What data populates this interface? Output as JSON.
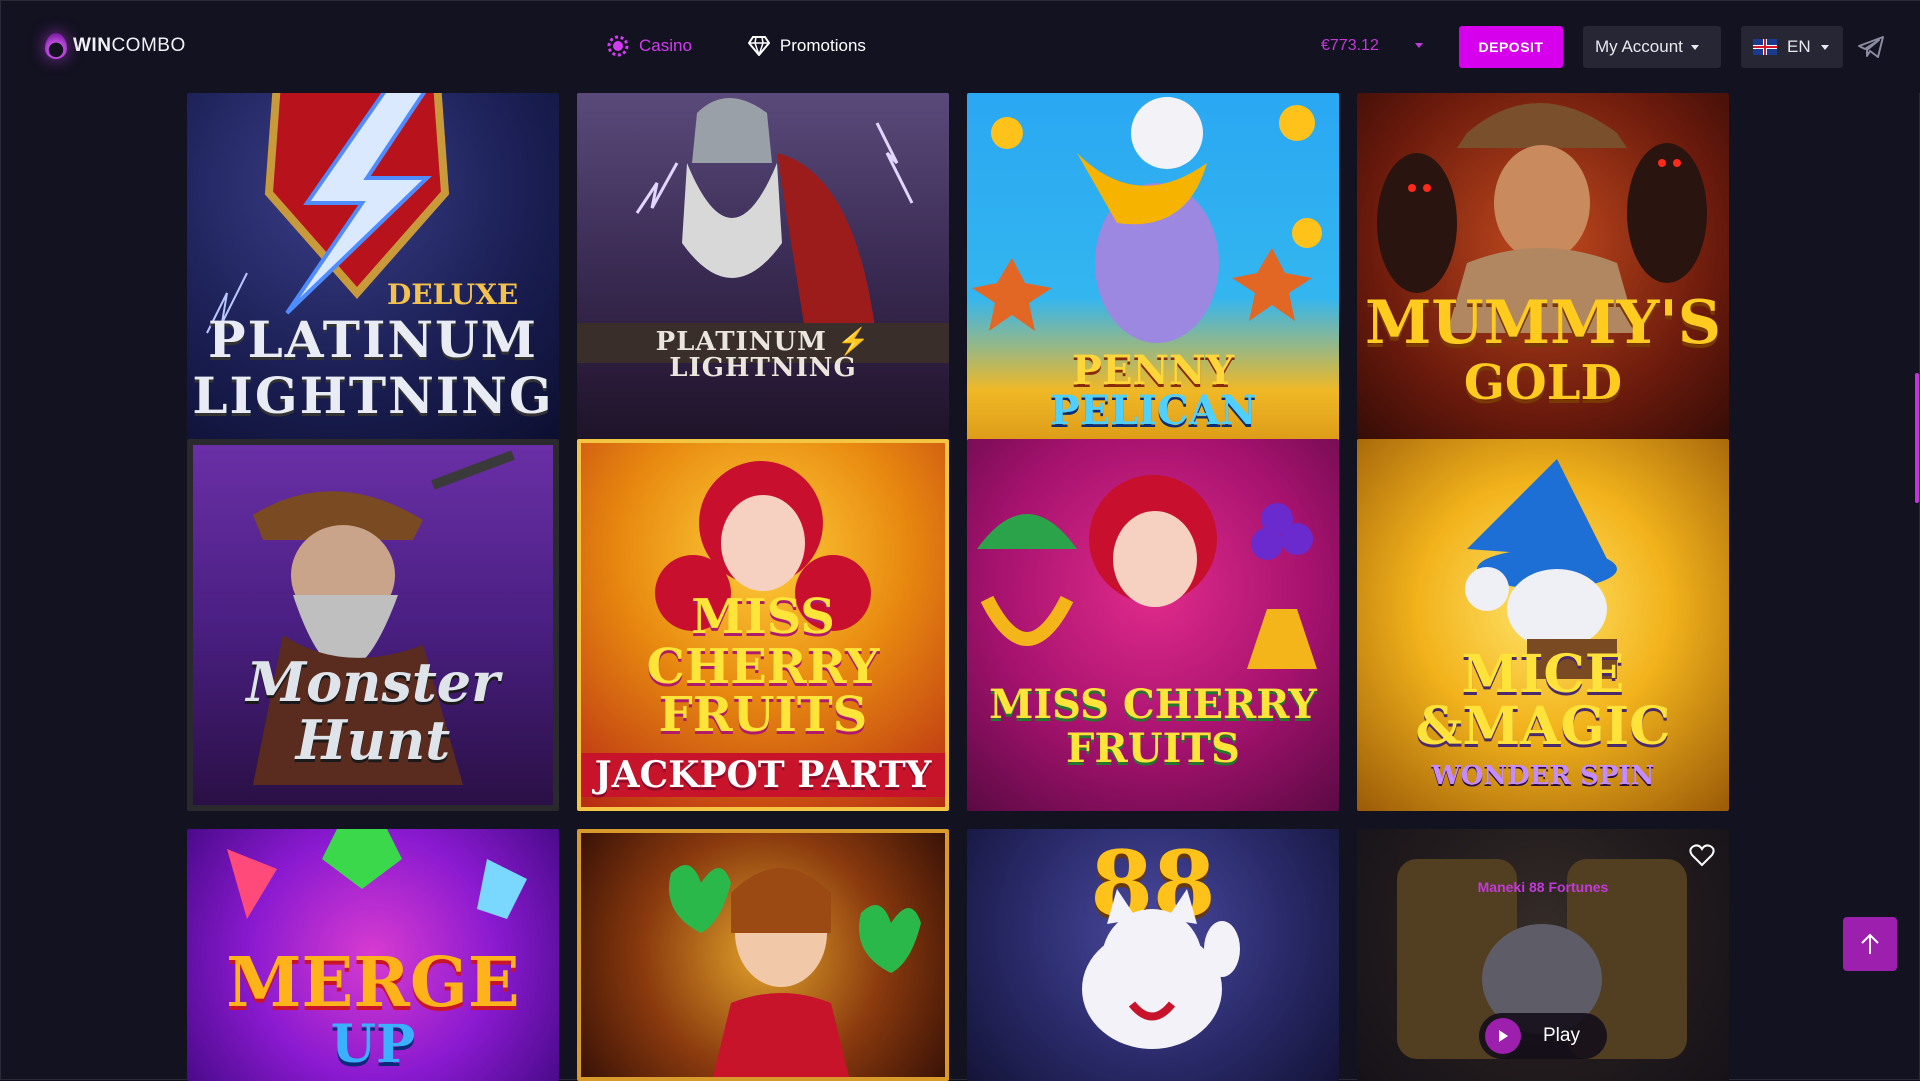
{
  "header": {
    "logo_text_bold": "WIN",
    "logo_text_rest": "COMBO",
    "nav": [
      {
        "label": "Casino",
        "icon": "casino-chip-icon"
      },
      {
        "label": "Promotions",
        "icon": "diamond-icon"
      }
    ],
    "balance": "€773.12",
    "deposit_label": "DEPOSIT",
    "account_label": "My Account",
    "language_label": "EN"
  },
  "games": [
    {
      "title_top": "DELUXE",
      "title_line1": "PLATINUM",
      "title_line2": "LIGHTNING"
    },
    {
      "title_line1": "PLATINUM",
      "title_line2": "LIGHTNING"
    },
    {
      "title_line1": "PENNY",
      "title_line2": "PELICAN"
    },
    {
      "title_line1": "MUMMY'S",
      "title_line2": "GOLD"
    },
    {
      "title_line1": "Monster",
      "title_line2": "Hunt"
    },
    {
      "title_line1": "MISS",
      "title_line2": "CHERRY",
      "title_line3": "FRUITS",
      "title_line4": "JACKPOT PARTY"
    },
    {
      "title_line1": "MISS CHERRY",
      "title_line2": "FRUITS"
    },
    {
      "title_line1": "MICE",
      "title_line2": "&MAGIC",
      "title_line3": "WONDER SPIN"
    },
    {
      "title_line1": "MERGE",
      "title_line2": "UP"
    },
    {},
    {
      "title_line1": "88"
    },
    {
      "provider": "Maneki 88 Fortunes",
      "play_label": "Play"
    }
  ],
  "colors": {
    "accent": "#d600ec",
    "background": "#121220",
    "active_nav": "#d23cf0"
  }
}
